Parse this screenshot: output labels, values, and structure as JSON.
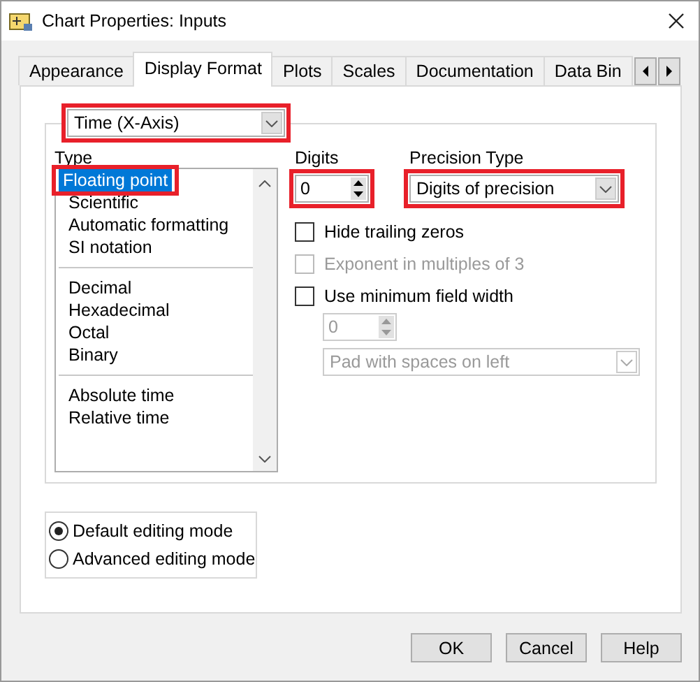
{
  "window": {
    "title": "Chart Properties: Inputs"
  },
  "tabs": [
    {
      "label": "Appearance",
      "selected": false
    },
    {
      "label": "Display Format",
      "selected": true
    },
    {
      "label": "Plots",
      "selected": false
    },
    {
      "label": "Scales",
      "selected": false
    },
    {
      "label": "Documentation",
      "selected": false
    },
    {
      "label": "Data Bin",
      "selected": false
    }
  ],
  "axis_select": {
    "value": "Time (X-Axis)",
    "highlighted": true
  },
  "type_list": {
    "label": "Type",
    "groups": [
      [
        {
          "label": "Floating point",
          "selected": true,
          "highlighted": true
        },
        {
          "label": "Scientific",
          "selected": false,
          "highlighted": false
        },
        {
          "label": "Automatic formatting",
          "selected": false,
          "highlighted": false
        },
        {
          "label": "SI notation",
          "selected": false,
          "highlighted": false
        }
      ],
      [
        {
          "label": "Decimal",
          "selected": false,
          "highlighted": false
        },
        {
          "label": "Hexadecimal",
          "selected": false,
          "highlighted": false
        },
        {
          "label": "Octal",
          "selected": false,
          "highlighted": false
        },
        {
          "label": "Binary",
          "selected": false,
          "highlighted": false
        }
      ],
      [
        {
          "label": "Absolute time",
          "selected": false,
          "highlighted": false
        },
        {
          "label": "Relative time",
          "selected": false,
          "highlighted": false
        }
      ]
    ]
  },
  "digits": {
    "label": "Digits",
    "value": "0",
    "highlighted": true
  },
  "precision": {
    "label": "Precision Type",
    "value": "Digits of precision",
    "highlighted": true
  },
  "options": [
    {
      "label": "Hide trailing zeros",
      "checked": false,
      "disabled": false
    },
    {
      "label": "Exponent in multiples of 3",
      "checked": false,
      "disabled": true
    },
    {
      "label": "Use minimum field width",
      "checked": false,
      "disabled": false
    }
  ],
  "min_width": {
    "value": "0",
    "disabled": true
  },
  "padding_select": {
    "value": "Pad with spaces on left",
    "disabled": true
  },
  "editing_modes": [
    {
      "label": "Default editing mode",
      "selected": true
    },
    {
      "label": "Advanced editing mode",
      "selected": false
    }
  ],
  "buttons": [
    "OK",
    "Cancel",
    "Help"
  ]
}
